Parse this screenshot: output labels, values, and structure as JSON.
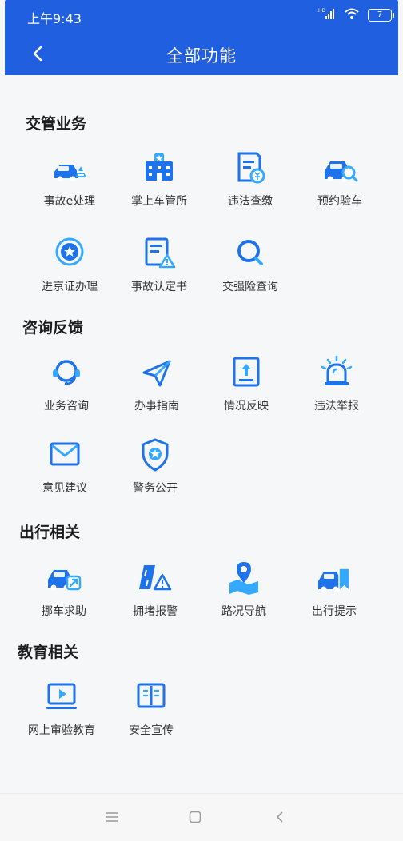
{
  "status_bar": {
    "time": "上午9:43",
    "battery": "7"
  },
  "header": {
    "title": "全部功能"
  },
  "sections": [
    {
      "title": "交管业务",
      "items": [
        {
          "label": "事故e处理",
          "icon": "accident-handling-icon"
        },
        {
          "label": "掌上车管所",
          "icon": "vehicle-office-icon"
        },
        {
          "label": "违法查缴",
          "icon": "violation-payment-icon"
        },
        {
          "label": "预约验车",
          "icon": "vehicle-inspection-icon"
        },
        {
          "label": "进京证办理",
          "icon": "beijing-permit-icon"
        },
        {
          "label": "事故认定书",
          "icon": "accident-report-icon"
        },
        {
          "label": "交强险查询",
          "icon": "insurance-search-icon"
        }
      ]
    },
    {
      "title": "咨询反馈",
      "items": [
        {
          "label": "业务咨询",
          "icon": "headset-icon"
        },
        {
          "label": "办事指南",
          "icon": "paper-plane-icon"
        },
        {
          "label": "情况反映",
          "icon": "upload-report-icon"
        },
        {
          "label": "违法举报",
          "icon": "alarm-light-icon"
        },
        {
          "label": "意见建议",
          "icon": "mail-icon"
        },
        {
          "label": "警务公开",
          "icon": "police-shield-icon"
        }
      ]
    },
    {
      "title": "出行相关",
      "items": [
        {
          "label": "挪车求助",
          "icon": "move-car-icon"
        },
        {
          "label": "拥堵报警",
          "icon": "congestion-warning-icon"
        },
        {
          "label": "路况导航",
          "icon": "road-navigation-icon"
        },
        {
          "label": "出行提示",
          "icon": "travel-tip-icon"
        }
      ]
    },
    {
      "title": "教育相关",
      "items": [
        {
          "label": "网上审验教育",
          "icon": "online-video-icon"
        },
        {
          "label": "安全宣传",
          "icon": "safety-book-icon"
        }
      ]
    }
  ],
  "colors": {
    "header": "#1f5fe0",
    "icon_primary": "#1f73ea",
    "icon_secondary": "#35a8ff"
  }
}
